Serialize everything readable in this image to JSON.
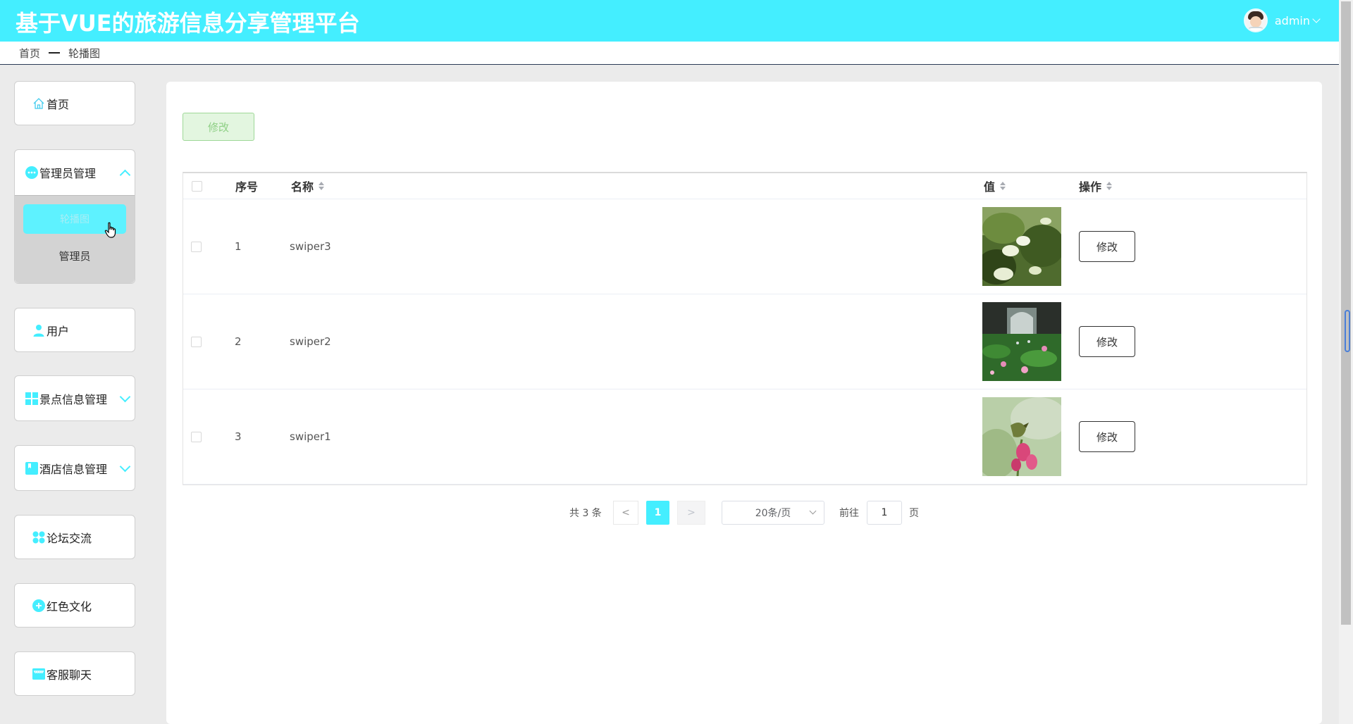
{
  "header": {
    "title": "基于VUE的旅游信息分享管理平台",
    "username": "admin"
  },
  "breadcrumb": {
    "home": "首页",
    "current": "轮播图"
  },
  "sidebar": {
    "home": "首页",
    "admin_mgmt": "管理员管理",
    "admin_sub_active": "轮播图",
    "admin_sub_item": "管理员",
    "users": "用户",
    "scenic": "景点信息管理",
    "hotel": "酒店信息管理",
    "forum": "论坛交流",
    "red_culture": "红色文化",
    "chat": "客服聊天"
  },
  "toolbar": {
    "edit_label": "修改"
  },
  "table": {
    "headers": {
      "index": "序号",
      "name": "名称",
      "value": "值",
      "action": "操作"
    },
    "rows": [
      {
        "index": "1",
        "name": "swiper3",
        "action": "修改"
      },
      {
        "index": "2",
        "name": "swiper2",
        "action": "修改"
      },
      {
        "index": "3",
        "name": "swiper1",
        "action": "修改"
      }
    ]
  },
  "pagination": {
    "total": "共 3 条",
    "prev": "<",
    "current": "1",
    "next": ">",
    "page_size": "20条/页",
    "goto_label": "前往",
    "goto_value": "1",
    "page_suffix": "页"
  },
  "colors": {
    "accent": "#44eeff",
    "edit_green": "#9fd898"
  }
}
